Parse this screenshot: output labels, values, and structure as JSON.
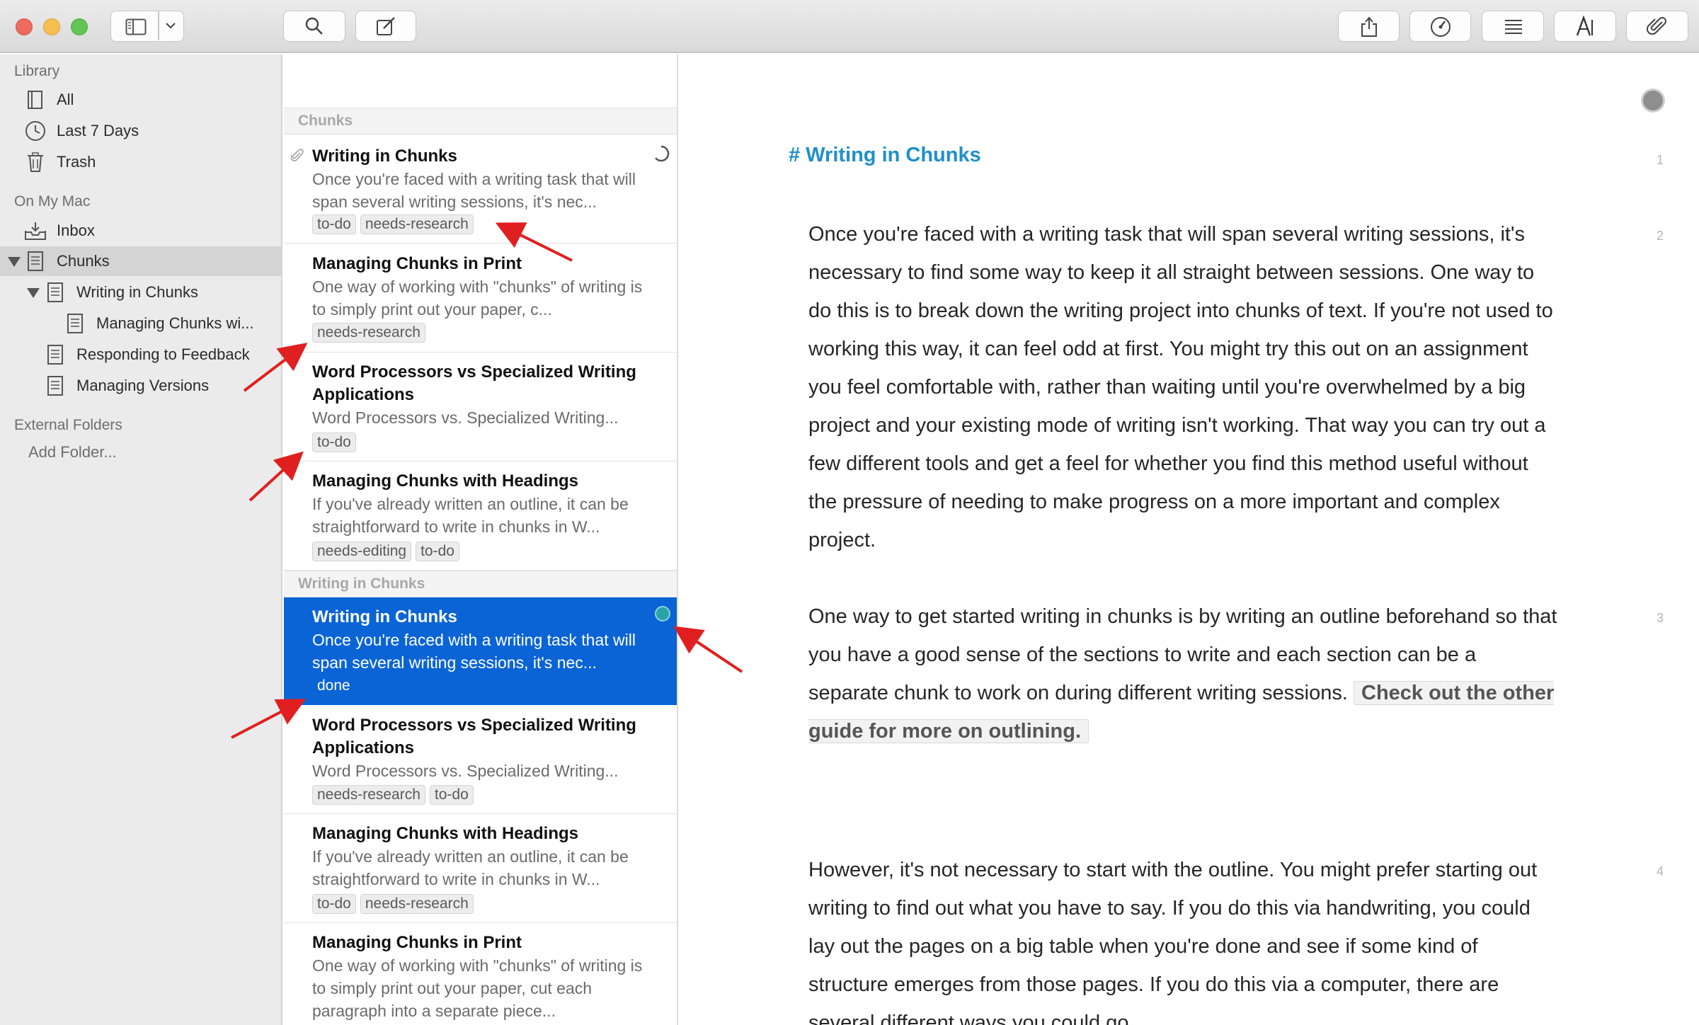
{
  "toolbar": {
    "traffic_colors": [
      "#ed6a5e",
      "#f5bf4f",
      "#61c454"
    ],
    "left_icons": [
      "sidebar-toggle-icon",
      "chevron-down-icon",
      "search-icon",
      "compose-icon"
    ],
    "right_icons": [
      "share-icon",
      "gauge-icon",
      "list-icon",
      "font-icon",
      "paperclip-icon"
    ]
  },
  "sidebar": {
    "library_header": "Library",
    "all": "All",
    "last7": "Last 7 Days",
    "trash": "Trash",
    "mac_header": "On My Mac",
    "inbox": "Inbox",
    "chunks": "Chunks",
    "writing_in_chunks": "Writing in Chunks",
    "managing_chunks_wi": "Managing Chunks wi...",
    "responding": "Responding to Feedback",
    "managing_versions": "Managing Versions",
    "external_header": "External Folders",
    "add_folder": "Add Folder..."
  },
  "list": {
    "section1": "Chunks",
    "section2": "Writing in Chunks",
    "notes": [
      {
        "title": "Writing in Chunks",
        "snippet": "Once you're faced with a writing task that will span several writing sessions, it's nec...",
        "tags": [
          "to-do",
          "needs-research"
        ]
      },
      {
        "title": "Managing Chunks in Print",
        "snippet": "One way of working with \"chunks\" of writing is to simply print out your paper, c...",
        "tags": [
          "needs-research"
        ]
      },
      {
        "title": "Word Processors vs Specialized Writing Applications",
        "snippet": "Word Processors vs. Specialized Writing...",
        "tags": [
          "to-do"
        ]
      },
      {
        "title": "Managing Chunks with Headings",
        "snippet": "If you've already written an outline, it can be straightforward to write in chunks in W...",
        "tags": [
          "needs-editing",
          "to-do"
        ]
      },
      {
        "title": "Writing in Chunks",
        "snippet": "Once you're faced with a writing task that will span several writing sessions, it's nec...",
        "tags": [
          "done"
        ]
      },
      {
        "title": "Word Processors vs Specialized Writing Applications",
        "snippet": "Word Processors vs. Specialized Writing...",
        "tags": [
          "needs-research",
          "to-do"
        ]
      },
      {
        "title": "Managing Chunks with Headings",
        "snippet": "If you've already written an outline, it can be straightforward to write in chunks in W...",
        "tags": [
          "to-do",
          "needs-research"
        ]
      },
      {
        "title": "Managing Chunks in Print",
        "snippet": "One way of working with \"chunks\" of writing is to simply print out your paper, cut each paragraph into a separate piece...",
        "tags": []
      }
    ],
    "selected_color": "#0a64d6",
    "status_dot_color": "#29a3a3"
  },
  "editor": {
    "title": "# Writing in Chunks",
    "line_numbers": [
      "1",
      "2",
      "3",
      "4"
    ],
    "para1": "Once you're faced with a writing task that will span several writing sessions, it's necessary to find some way to keep it all straight between sessions. One way to do this is to break down the writing project into chunks of text. If you're not used to working this way, it can feel odd at first. You might try this out on an assignment you feel comfortable with, rather than waiting until you're overwhelmed by a big project and your existing mode of writing isn't working. That way you can try out a few different tools and get a feel for whether you find this method useful without the pressure of needing to make progress on a more important and complex project.",
    "para2": "One way to get started writing in chunks is by writing an outline beforehand so that you have a good sense of the sections to write and each section can be a separate chunk to work on during different writing sessions.",
    "para2_link": "Check out the other guide for more on outlining.",
    "para4": "However, it's not necessary to start with the outline. You might prefer starting out writing to find out what you have to say. If you do this via handwriting, you could lay out the pages on a big table when you're done and see if some kind of structure emerges from those pages. If you do this via a computer, there are several different ways you could go.",
    "title_color": "#1f8fcb"
  },
  "annotation_color": "#e02020"
}
